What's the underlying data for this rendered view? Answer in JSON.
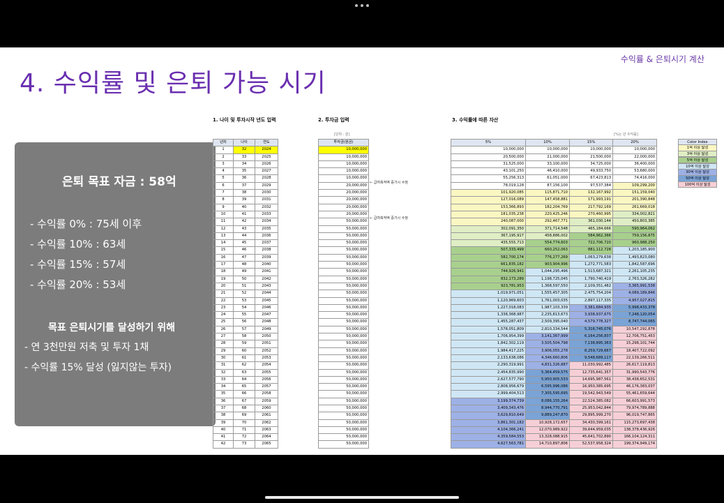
{
  "header": {
    "top_right": "수익률 & 은퇴시기 계산",
    "title": "4. 수익률 및 은퇴 가능 시기"
  },
  "summary": {
    "goal": "은퇴 목표 자금 : 58억",
    "lines": [
      "- 수익률   0% : 75세 이후",
      "- 수익률 10% : 63세",
      "- 수익률 15% : 57세",
      "- 수익률 20% : 53세"
    ],
    "subtitle": "목표 은퇴시기를 달성하기 위해",
    "actions": [
      "- 연 3천만원 저축 및 투자 1채",
      "- 수익률 15% 달성 (잃지않는 투자)"
    ]
  },
  "sections": {
    "s1": "1. 나이 및 투자시작 년도 입력",
    "s2": "2. 투자금 입력",
    "s2_unit": "[단위 : 원]",
    "s3": "3. 수익률에 따른 자산",
    "s3_unit": "[%는 년 수익률]"
  },
  "table1": {
    "headers": [
      "년차",
      "나이",
      "연도"
    ]
  },
  "table2": {
    "header": "투자금(원금)"
  },
  "table3": {
    "headers": [
      "5%",
      "10%",
      "15%",
      "20%"
    ]
  },
  "notes": [
    "← 급여축적액 증가시 수정",
    "← 급여축적액 증가시 수정"
  ],
  "color_index": {
    "title": "Color Index",
    "items": [
      {
        "label": "1억 이상 달성",
        "color": "#fbf7c2"
      },
      {
        "label": "3억 이상 달성",
        "color": "#dfeec4"
      },
      {
        "label": "5억 이상 달성",
        "color": "#a8d08d"
      },
      {
        "label": "10억 이상 달성",
        "color": "#cfe7f5"
      },
      {
        "label": "30억 이상 달성",
        "color": "#9db1e6"
      },
      {
        "label": "50억 이상 달성",
        "color": "#7aa3d6"
      },
      {
        "label": "100억 이상 달성",
        "color": "#f6cfd6"
      }
    ]
  },
  "rows": [
    {
      "n": "1",
      "age": "32",
      "year": "2024",
      "inv": "10,000,000",
      "r5": "10,000,000",
      "r10": "10,000,000",
      "r15": "10,000,000",
      "r20": "10,000,000"
    },
    {
      "n": "2",
      "age": "33",
      "year": "2025",
      "inv": "10,000,000",
      "r5": "20,500,000",
      "r10": "21,000,000",
      "r15": "21,500,000",
      "r20": "22,000,000"
    },
    {
      "n": "3",
      "age": "34",
      "year": "2026",
      "inv": "10,000,000",
      "r5": "31,525,000",
      "r10": "33,100,000",
      "r15": "34,725,000",
      "r20": "36,400,000"
    },
    {
      "n": "4",
      "age": "35",
      "year": "2027",
      "inv": "10,000,000",
      "r5": "43,101,250",
      "r10": "46,410,000",
      "r15": "49,933,750",
      "r20": "53,680,000"
    },
    {
      "n": "5",
      "age": "36",
      "year": "2028",
      "inv": "10,000,000",
      "r5": "55,256,313",
      "r10": "61,051,000",
      "r15": "67,423,813",
      "r20": "74,416,000"
    },
    {
      "n": "6",
      "age": "37",
      "year": "2029",
      "inv": "20,000,000",
      "r5": "78,019,128",
      "r10": "87,156,100",
      "r15": "97,537,384",
      "r20": "109,299,200"
    },
    {
      "n": "7",
      "age": "38",
      "year": "2030",
      "inv": "20,000,000",
      "r5": "101,920,085",
      "r10": "115,871,710",
      "r15": "132,167,992",
      "r20": "151,159,040"
    },
    {
      "n": "8",
      "age": "39",
      "year": "2031",
      "inv": "20,000,000",
      "r5": "127,016,089",
      "r10": "147,458,881",
      "r15": "171,993,191",
      "r20": "201,390,848"
    },
    {
      "n": "9",
      "age": "40",
      "year": "2032",
      "inv": "20,000,000",
      "r5": "153,366,893",
      "r10": "182,204,769",
      "r15": "217,792,169",
      "r20": "261,669,018"
    },
    {
      "n": "10",
      "age": "41",
      "year": "2033",
      "inv": "20,000,000",
      "r5": "181,035,238",
      "r10": "220,425,246",
      "r15": "270,460,995",
      "r20": "334,002,821"
    },
    {
      "n": "11",
      "age": "42",
      "year": "2034",
      "inv": "50,000,000",
      "r5": "240,087,000",
      "r10": "292,467,771",
      "r15": "361,030,144",
      "r20": "450,803,385"
    },
    {
      "n": "12",
      "age": "43",
      "year": "2035",
      "inv": "50,000,000",
      "r5": "302,091,350",
      "r10": "371,714,548",
      "r15": "465,184,666",
      "r20": "590,964,062"
    },
    {
      "n": "13",
      "age": "44",
      "year": "2036",
      "inv": "50,000,000",
      "r5": "367,195,917",
      "r10": "458,886,002",
      "r15": "584,962,366",
      "r20": "759,156,875"
    },
    {
      "n": "14",
      "age": "45",
      "year": "2037",
      "inv": "50,000,000",
      "r5": "435,555,713",
      "r10": "554,774,603",
      "r15": "722,706,720",
      "r20": "960,988,250"
    },
    {
      "n": "15",
      "age": "46",
      "year": "2038",
      "inv": "50,000,000",
      "r5": "507,333,499",
      "r10": "660,252,063",
      "r15": "881,112,728",
      "r20": "1,203,185,900"
    },
    {
      "n": "16",
      "age": "47",
      "year": "2039",
      "inv": "50,000,000",
      "r5": "582,700,174",
      "r10": "776,277,269",
      "r15": "1,063,279,638",
      "r20": "1,493,823,080"
    },
    {
      "n": "17",
      "age": "48",
      "year": "2040",
      "inv": "50,000,000",
      "r5": "661,835,182",
      "r10": "903,904,996",
      "r15": "1,272,771,583",
      "r20": "1,842,587,696"
    },
    {
      "n": "18",
      "age": "49",
      "year": "2041",
      "inv": "50,000,000",
      "r5": "744,926,941",
      "r10": "1,044,295,496",
      "r15": "1,513,687,321",
      "r20": "2,261,105,235"
    },
    {
      "n": "19",
      "age": "50",
      "year": "2042",
      "inv": "50,000,000",
      "r5": "832,173,289",
      "r10": "1,198,725,045",
      "r15": "1,790,740,419",
      "r20": "2,763,326,282"
    },
    {
      "n": "20",
      "age": "51",
      "year": "2043",
      "inv": "50,000,000",
      "r5": "923,781,953",
      "r10": "1,368,597,550",
      "r15": "2,109,351,482",
      "r20": "3,365,991,538"
    },
    {
      "n": "21",
      "age": "52",
      "year": "2044",
      "inv": "50,000,000",
      "r5": "1,019,971,051",
      "r10": "1,555,457,305",
      "r15": "2,475,754,204",
      "r20": "4,089,189,846"
    },
    {
      "n": "22",
      "age": "53",
      "year": "2045",
      "inv": "50,000,000",
      "r5": "1,120,969,603",
      "r10": "1,761,003,035",
      "r15": "2,897,117,335",
      "r20": "4,957,027,815"
    },
    {
      "n": "23",
      "age": "54",
      "year": "2046",
      "inv": "50,000,000",
      "r5": "1,227,018,083",
      "r10": "1,987,103,339",
      "r15": "3,381,684,935",
      "r20": "5,998,433,378"
    },
    {
      "n": "24",
      "age": "55",
      "year": "2047",
      "inv": "50,000,000",
      "r5": "1,338,368,987",
      "r10": "2,235,813,673",
      "r15": "3,938,937,675",
      "r20": "7,248,120,054"
    },
    {
      "n": "25",
      "age": "56",
      "year": "2048",
      "inv": "50,000,000",
      "r5": "1,455,287,437",
      "r10": "2,509,395,040",
      "r15": "4,579,778,327",
      "r20": "8,747,744,065"
    },
    {
      "n": "26",
      "age": "57",
      "year": "2049",
      "inv": "50,000,000",
      "r5": "1,578,051,809",
      "r10": "2,810,334,544",
      "r15": "5,316,745,076",
      "r20": "10,547,292,878"
    },
    {
      "n": "27",
      "age": "58",
      "year": "2050",
      "inv": "50,000,000",
      "r5": "1,706,954,399",
      "r10": "3,141,367,999",
      "r15": "6,164,256,837",
      "r20": "12,706,751,453"
    },
    {
      "n": "28",
      "age": "59",
      "year": "2051",
      "inv": "50,000,000",
      "r5": "1,842,302,119",
      "r10": "3,505,504,798",
      "r15": "7,138,895,363",
      "r20": "15,298,101,744"
    },
    {
      "n": "29",
      "age": "60",
      "year": "2052",
      "inv": "50,000,000",
      "r5": "1,984,417,225",
      "r10": "3,906,055,278",
      "r15": "8,259,729,667",
      "r20": "18,407,722,092"
    },
    {
      "n": "30",
      "age": "61",
      "year": "2053",
      "inv": "50,000,000",
      "r5": "2,133,638,086",
      "r10": "4,346,660,806",
      "r15": "9,548,689,117",
      "r20": "22,139,266,511"
    },
    {
      "n": "31",
      "age": "62",
      "year": "2054",
      "inv": "50,000,000",
      "r5": "2,290,319,991",
      "r10": "4,831,326,887",
      "r15": "11,030,992,485",
      "r20": "26,617,119,813"
    },
    {
      "n": "32",
      "age": "63",
      "year": "2055",
      "inv": "50,000,000",
      "r5": "2,454,835,990",
      "r10": "5,364,459,575",
      "r15": "12,735,641,357",
      "r20": "31,990,543,776"
    },
    {
      "n": "33",
      "age": "64",
      "year": "2056",
      "inv": "50,000,000",
      "r5": "2,627,577,790",
      "r10": "5,950,905,533",
      "r15": "14,695,987,561",
      "r20": "38,438,652,531"
    },
    {
      "n": "34",
      "age": "65",
      "year": "2057",
      "inv": "50,000,000",
      "r5": "2,808,956,679",
      "r10": "6,595,996,086",
      "r15": "16,950,385,695",
      "r20": "46,176,383,037"
    },
    {
      "n": "35",
      "age": "66",
      "year": "2058",
      "inv": "50,000,000",
      "r5": "2,999,404,513",
      "r10": "7,305,595,695",
      "r15": "19,542,943,549",
      "r20": "55,461,659,644"
    },
    {
      "n": "36",
      "age": "67",
      "year": "2059",
      "inv": "50,000,000",
      "r5": "3,199,374,739",
      "r10": "8,086,155,264",
      "r15": "22,524,385,082",
      "r20": "66,603,991,573"
    },
    {
      "n": "37",
      "age": "68",
      "year": "2060",
      "inv": "50,000,000",
      "r5": "3,409,343,476",
      "r10": "8,944,770,791",
      "r15": "25,953,042,844",
      "r20": "79,974,789,888"
    },
    {
      "n": "38",
      "age": "69",
      "year": "2061",
      "inv": "50,000,000",
      "r5": "3,629,810,649",
      "r10": "9,889,247,870",
      "r15": "29,895,999,270",
      "r20": "96,019,747,865"
    },
    {
      "n": "39",
      "age": "70",
      "year": "2062",
      "inv": "50,000,000",
      "r5": "3,861,301,182",
      "r10": "10,928,172,657",
      "r15": "34,430,399,161",
      "r20": "115,273,697,438"
    },
    {
      "n": "40",
      "age": "71",
      "year": "2063",
      "inv": "50,000,000",
      "r5": "4,104,366,241",
      "r10": "12,070,989,922",
      "r15": "39,644,959,035",
      "r20": "138,378,436,926"
    },
    {
      "n": "41",
      "age": "72",
      "year": "2064",
      "inv": "50,000,000",
      "r5": "4,359,584,553",
      "r10": "13,328,088,915",
      "r15": "45,641,702,890",
      "r20": "166,104,124,311"
    },
    {
      "n": "42",
      "age": "73",
      "year": "2065",
      "inv": "50,000,000",
      "r5": "4,627,563,781",
      "r10": "14,710,897,806",
      "r15": "52,537,958,324",
      "r20": "199,374,949,174"
    }
  ]
}
